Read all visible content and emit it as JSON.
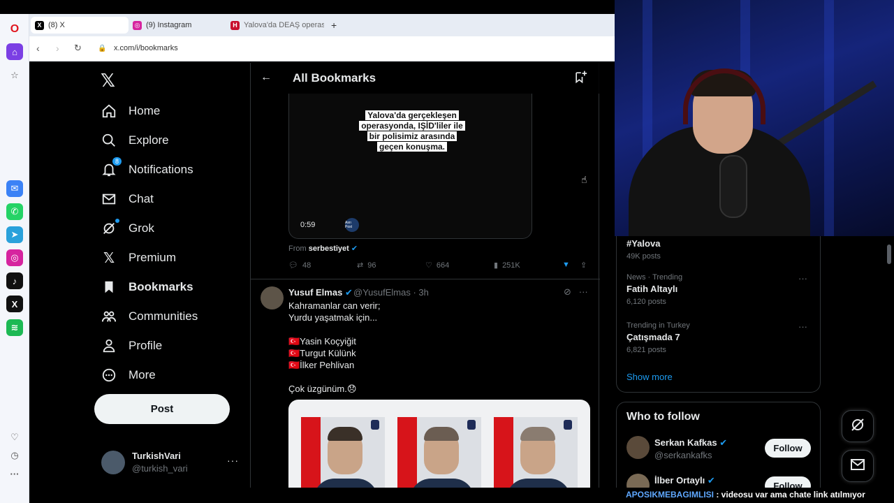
{
  "browser": {
    "tabs": [
      {
        "title": "(8) X",
        "active": true,
        "favicon": "x-icon"
      },
      {
        "title": "(9) Instagram",
        "active": false,
        "favicon": "instagram-icon"
      },
      {
        "title": "Yalova'da DEAŞ operasyon",
        "active": false,
        "favicon": "haberturk-icon"
      }
    ],
    "new_tab": "+",
    "url": "x.com/i/bookmarks",
    "sidebar_apps": [
      "messenger-icon",
      "whatsapp-icon",
      "telegram-icon",
      "instagram-icon",
      "tiktok-icon",
      "x-icon",
      "spotify-icon"
    ]
  },
  "nav": {
    "items": [
      {
        "label": "Home",
        "icon": "home-icon"
      },
      {
        "label": "Explore",
        "icon": "search-icon"
      },
      {
        "label": "Notifications",
        "icon": "bell-icon",
        "badge": "8"
      },
      {
        "label": "Chat",
        "icon": "mail-icon"
      },
      {
        "label": "Grok",
        "icon": "grok-icon"
      },
      {
        "label": "Premium",
        "icon": "x-icon"
      },
      {
        "label": "Bookmarks",
        "icon": "bookmark-icon"
      },
      {
        "label": "Communities",
        "icon": "communities-icon"
      },
      {
        "label": "Profile",
        "icon": "profile-icon"
      },
      {
        "label": "More",
        "icon": "more-icon"
      }
    ],
    "post_label": "Post",
    "account": {
      "name": "TurkishVari",
      "handle": "@turkish_vari"
    }
  },
  "main": {
    "title": "All Bookmarks",
    "tweet1": {
      "video_caption": "Yalova'da gerçekleşen operasyonda, IŞİD'liler ile bir polisimiz arasında geçen konuşma.",
      "video_time": "0:59",
      "video_logo": "Asrı Post",
      "from_label": "From",
      "from_user": "serbestiyet",
      "replies": "48",
      "reposts": "96",
      "likes": "664",
      "views": "251K"
    },
    "tweet2": {
      "name": "Yusuf Elmas",
      "handle": "@YusufElmas",
      "time": "3h",
      "lines": [
        "Kahramanlar can verir;",
        "Yurdu yaşatmak için...",
        "",
        "🇹🇷Yasin Koçyiğit",
        "🇹🇷Turgut Külünk",
        "🇹🇷İlker Pehlivan",
        "",
        "Çok üzgünüm.😞"
      ]
    }
  },
  "right": {
    "trends": [
      {
        "category": "",
        "name": "#Yalova",
        "count": "49K posts",
        "more": false
      },
      {
        "category": "News · Trending",
        "name": "Fatih Altaylı",
        "count": "6,120 posts",
        "more": true
      },
      {
        "category": "Trending in Turkey",
        "name": "Çatışmada 7",
        "count": "6,821 posts",
        "more": true
      }
    ],
    "show_more": "Show more",
    "who_to_follow": "Who to follow",
    "suggestions": [
      {
        "name": "Serkan Kafkas",
        "handle": "@serkankafks",
        "button": "Follow"
      },
      {
        "name": "İlber Ortaylı",
        "handle": "",
        "button": "Follow"
      }
    ]
  },
  "overlay": {
    "ticker_user": "APOSIKMEBAGIMLISI",
    "ticker_message": " : videosu var ama chate link atılmıyor"
  },
  "colors": {
    "accent": "#1d9bf0",
    "background": "#000000",
    "border": "#2f3336",
    "muted": "#71767b"
  }
}
